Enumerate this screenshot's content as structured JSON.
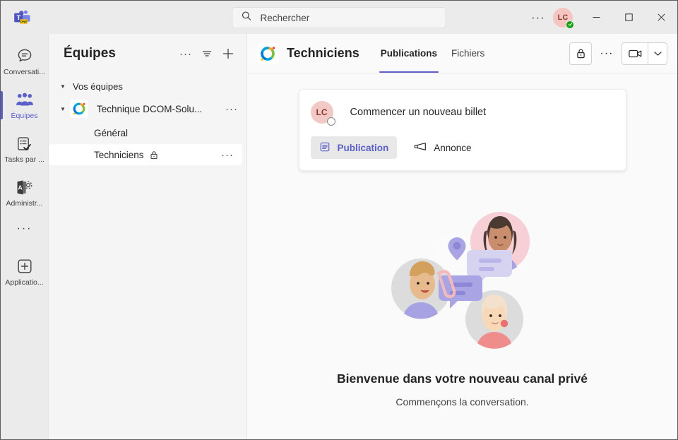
{
  "titlebar": {
    "logo_icon": "teams-logo-icon",
    "logo_badge": "PRE",
    "search": {
      "placeholder": "Rechercher",
      "value": "",
      "icon": "search-icon"
    },
    "more_icon": "ellipsis-icon",
    "avatar": {
      "initials": "LC",
      "presence": "available",
      "color": "#f5c6c1"
    },
    "window": {
      "minimize_icon": "minimize-icon",
      "maximize_icon": "maximize-icon",
      "close_icon": "close-icon"
    }
  },
  "rail": {
    "items": [
      {
        "label": "Conversati...",
        "icon": "chat-icon",
        "active": false
      },
      {
        "label": "Équipes",
        "icon": "teams-people-icon",
        "active": true
      },
      {
        "label": "Tasks par ...",
        "icon": "tasks-checklist-icon",
        "active": false
      },
      {
        "label": "Administr...",
        "icon": "admin-gear-icon",
        "active": false
      }
    ],
    "more_icon": "ellipsis-icon",
    "apps": {
      "label": "Applicatio...",
      "icon": "apps-plus-icon"
    }
  },
  "pane": {
    "title": "Équipes",
    "actions": [
      {
        "name": "more-options",
        "icon": "ellipsis-icon"
      },
      {
        "name": "filter",
        "icon": "filter-icon"
      },
      {
        "name": "join-or-create-team",
        "icon": "plus-icon"
      }
    ],
    "group_label": "Vos équipes",
    "team": {
      "name": "Technique DCOM-Solu...",
      "icon": "team-ring-logo-icon",
      "more_icon": "ellipsis-icon"
    },
    "channels": [
      {
        "name": "Général",
        "selected": false,
        "private": false
      },
      {
        "name": "Techniciens",
        "selected": true,
        "private": true,
        "lock_icon": "lock-icon",
        "more_icon": "ellipsis-icon"
      }
    ]
  },
  "main": {
    "header": {
      "team_icon": "team-ring-logo-icon",
      "channel_title": "Techniciens",
      "tabs": [
        {
          "label": "Publications",
          "active": true
        },
        {
          "label": "Fichiers",
          "active": false
        }
      ],
      "actions": [
        {
          "name": "private-channel-lock",
          "icon": "lock-icon"
        },
        {
          "name": "more-options",
          "icon": "ellipsis-icon"
        },
        {
          "name": "meet-now",
          "icon": "video-camera-icon"
        },
        {
          "name": "meet-options",
          "icon": "chevron-down-icon"
        }
      ]
    },
    "compose": {
      "avatar": {
        "initials": "LC",
        "presence": "offline"
      },
      "prompt": "Commencer un nouveau billet",
      "buttons": [
        {
          "label": "Publication",
          "icon": "post-icon",
          "active": true
        },
        {
          "label": "Annonce",
          "icon": "megaphone-icon",
          "active": false
        }
      ]
    },
    "empty_state": {
      "illustration": "people-chat-bubbles-illustration",
      "title": "Bienvenue dans votre nouveau canal privé",
      "subtitle": "Commençons la conversation."
    }
  },
  "colors": {
    "accent": "#5b5fc7",
    "presence_available": "#13a10e",
    "rail_bg": "#ebebeb",
    "pane_bg": "#f5f5f5",
    "main_bg": "#fafafa"
  }
}
